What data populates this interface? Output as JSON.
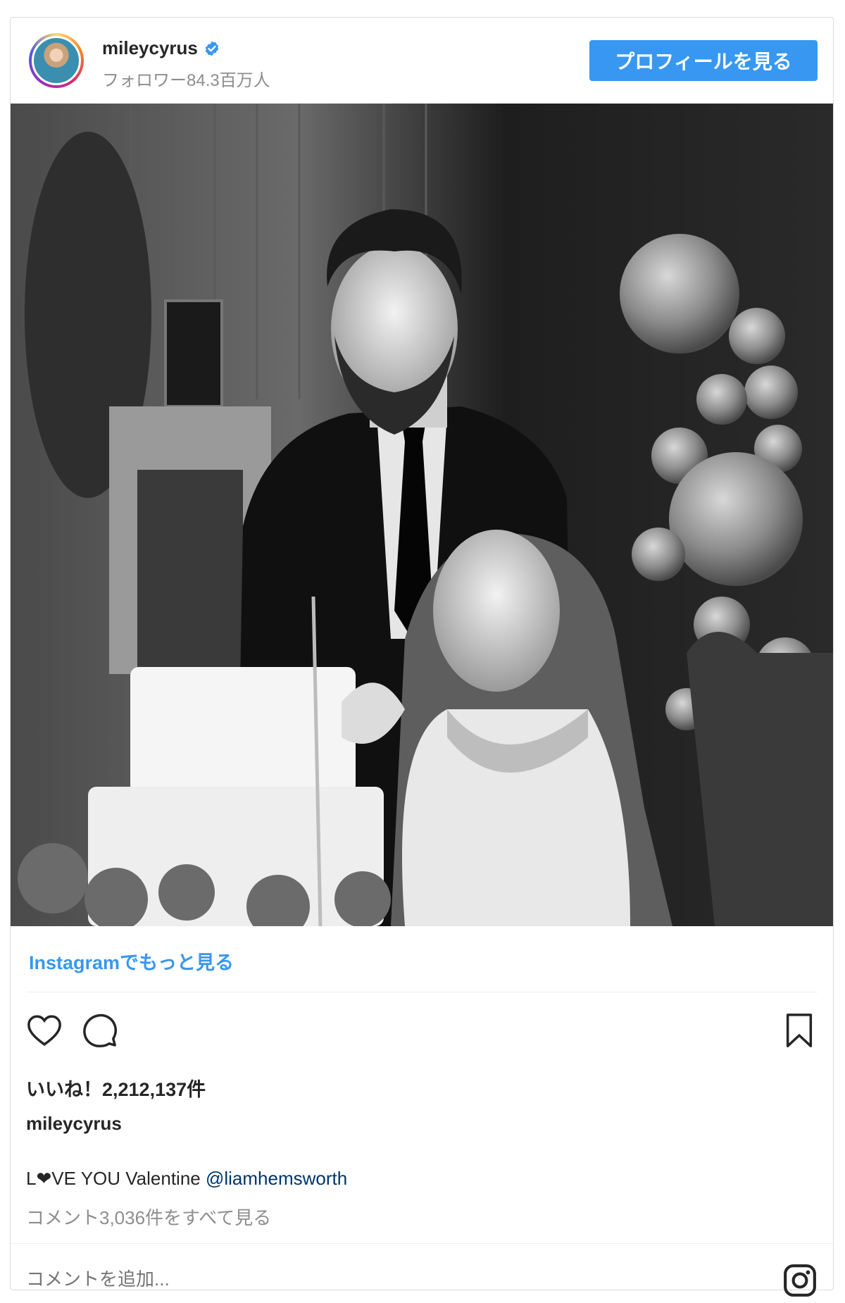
{
  "post": {
    "username": "mileycyrus",
    "followers": "フォロワー84.3百万人",
    "profile_button": "プロフィールを見る",
    "more_link": "Instagramでもっと見る",
    "likes": "いいね！2,212,137件",
    "caption_username": "mileycyrus",
    "caption_prefix": "L",
    "caption_heart": "❤",
    "caption_text": "VE YOU Valentine ",
    "caption_mention": "@liamhemsworth",
    "view_comments": "コメント3,036件をすべて見る",
    "comment_placeholder": "コメントを追加..."
  },
  "icons": {
    "verified": "verified-badge-icon",
    "like": "heart-icon",
    "comment": "comment-icon",
    "save": "bookmark-icon",
    "instagram": "instagram-icon"
  },
  "colors": {
    "button": "#3897f0",
    "link": "#3897f0",
    "mention": "#003569",
    "muted": "#8e8e8e",
    "text": "#262626"
  }
}
